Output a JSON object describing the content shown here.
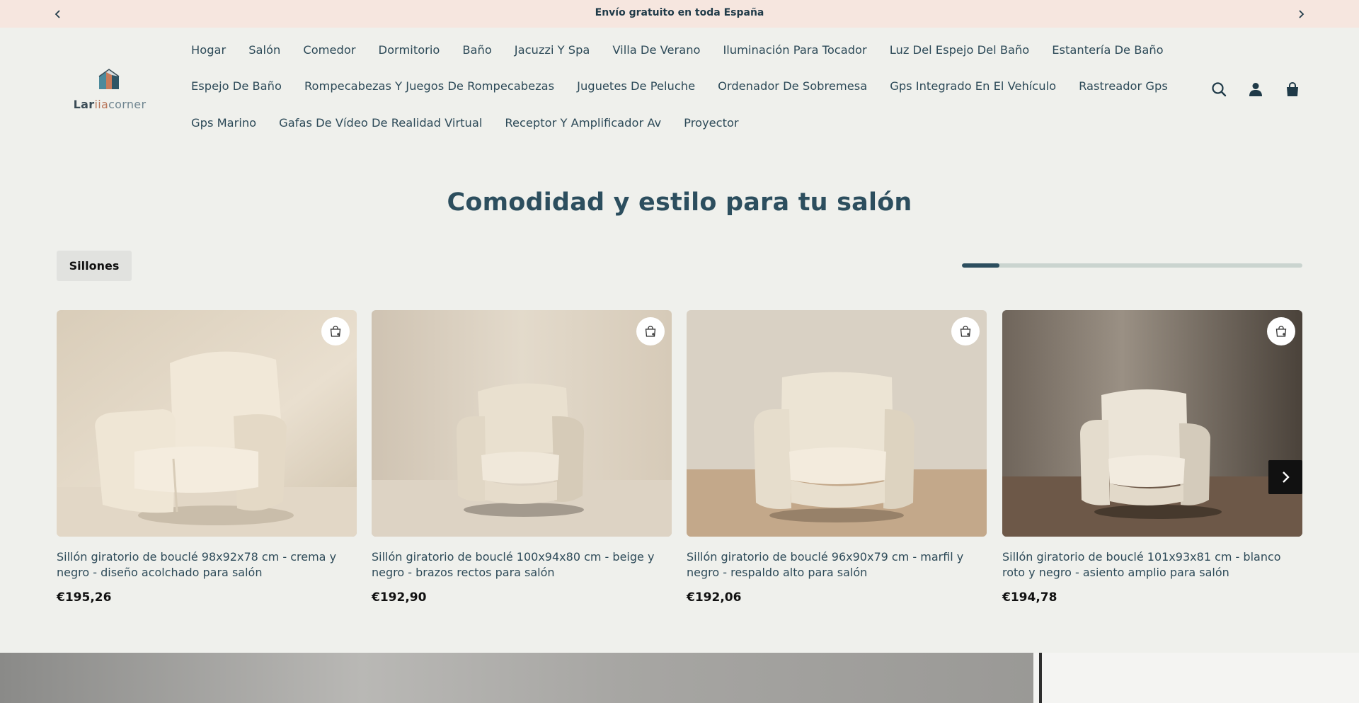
{
  "announcement": {
    "text": "Envío gratuito en toda España",
    "prev_icon": "chevron-left-icon",
    "next_icon": "chevron-right-icon"
  },
  "logo": {
    "part1": "Lar",
    "part2": "iia",
    "part3": "corner"
  },
  "nav": {
    "row1": [
      "Hogar",
      "Salón",
      "Comedor",
      "Dormitorio",
      "Baño",
      "Jacuzzi Y Spa",
      "Villa De Verano",
      "Iluminación Para Tocador",
      "Luz Del Espejo Del Baño",
      "Estantería De Baño"
    ],
    "row2": [
      "Espejo De Baño",
      "Rompecabezas Y Juegos De Rompecabezas",
      "Juguetes De Peluche",
      "Ordenador De Sobremesa",
      "Gps Integrado En El Vehículo",
      "Rastreador Gps"
    ],
    "row3": [
      "Gps Marino",
      "Gafas De Vídeo De Realidad Virtual",
      "Receptor Y Amplificador Av",
      "Proyector"
    ]
  },
  "header_icons": [
    "search-icon",
    "account-icon",
    "cart-icon"
  ],
  "section": {
    "title": "Comodidad y estilo para tu salón",
    "tab": "Sillones",
    "progress_fraction": 0.11
  },
  "products": [
    {
      "title": "Sillón giratorio de bouclé 98x92x78 cm - crema y negro - diseño acolchado para salón",
      "price": "€195,26"
    },
    {
      "title": "Sillón giratorio de bouclé 100x94x80 cm - beige y negro - brazos rectos para salón",
      "price": "€192,90"
    },
    {
      "title": "Sillón giratorio de bouclé 96x90x79 cm - marfil y negro - respaldo alto para salón",
      "price": "€192,06"
    },
    {
      "title": "Sillón giratorio de bouclé 101x93x81 cm - blanco roto y negro - asiento amplio para salón",
      "price": "€194,78"
    }
  ],
  "colors": {
    "announcement_bg": "#f6e6df",
    "page_bg": "#eff0ec",
    "accent": "#2c4e5e"
  }
}
